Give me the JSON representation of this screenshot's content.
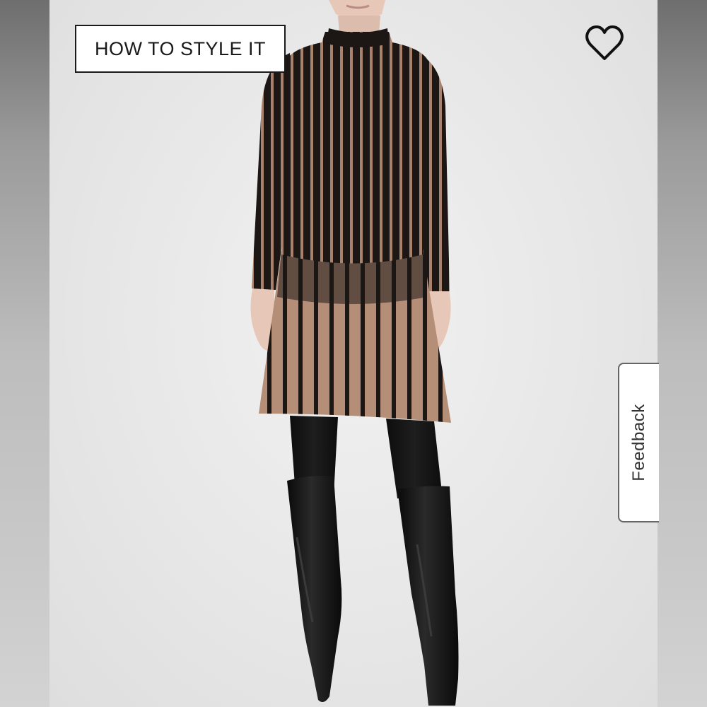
{
  "overlay": {
    "style_button_label": "HOW TO STYLE IT",
    "favorite_icon": "heart-outline-icon",
    "feedback_label": "Feedback"
  },
  "product_image": {
    "subject": "model wearing striped knit dress with black tights and knee-high boots",
    "colors": {
      "dress_base": "#1c1714",
      "dress_stripe": "#b58e78",
      "boots": "#141414",
      "skin": "#e6c7b8",
      "background": "#e7e7e7"
    }
  }
}
